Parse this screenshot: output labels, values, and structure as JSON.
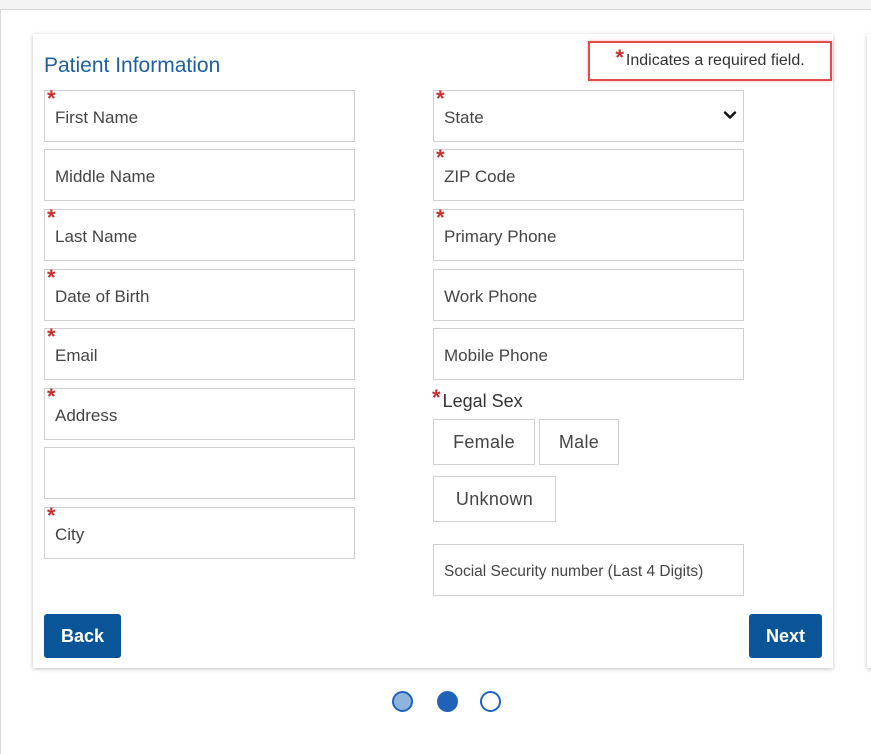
{
  "form": {
    "title": "Patient Information",
    "required_note": "Indicates a required field.",
    "required_marker": "*",
    "left_fields": [
      {
        "label": "First Name",
        "required": true
      },
      {
        "label": "Middle Name",
        "required": false
      },
      {
        "label": "Last Name",
        "required": true
      },
      {
        "label": "Date of Birth",
        "required": true
      },
      {
        "label": "Email",
        "required": true
      },
      {
        "label": "Address",
        "required": true
      },
      {
        "label": "",
        "required": false
      },
      {
        "label": "City",
        "required": true
      }
    ],
    "right_fields": [
      {
        "label": "State",
        "required": true
      },
      {
        "label": "ZIP Code",
        "required": true
      },
      {
        "label": "Primary Phone",
        "required": true
      },
      {
        "label": "Work Phone",
        "required": false
      },
      {
        "label": "Mobile Phone",
        "required": false
      }
    ],
    "legal_sex": {
      "label": "Legal Sex",
      "options": [
        "Female",
        "Male",
        "Unknown"
      ]
    },
    "ssn_placeholder": "Social Security number (Last 4 Digits)",
    "back_label": "Back",
    "next_label": "Next"
  },
  "steps": {
    "total": 3,
    "current": 2
  },
  "colors": {
    "accent": "#0a5597",
    "title": "#1f5f9e",
    "required": "#c9302c",
    "highlight_border": "#e24b4b",
    "step_done": "#8fb4dc",
    "step_current": "#1f63b8"
  }
}
